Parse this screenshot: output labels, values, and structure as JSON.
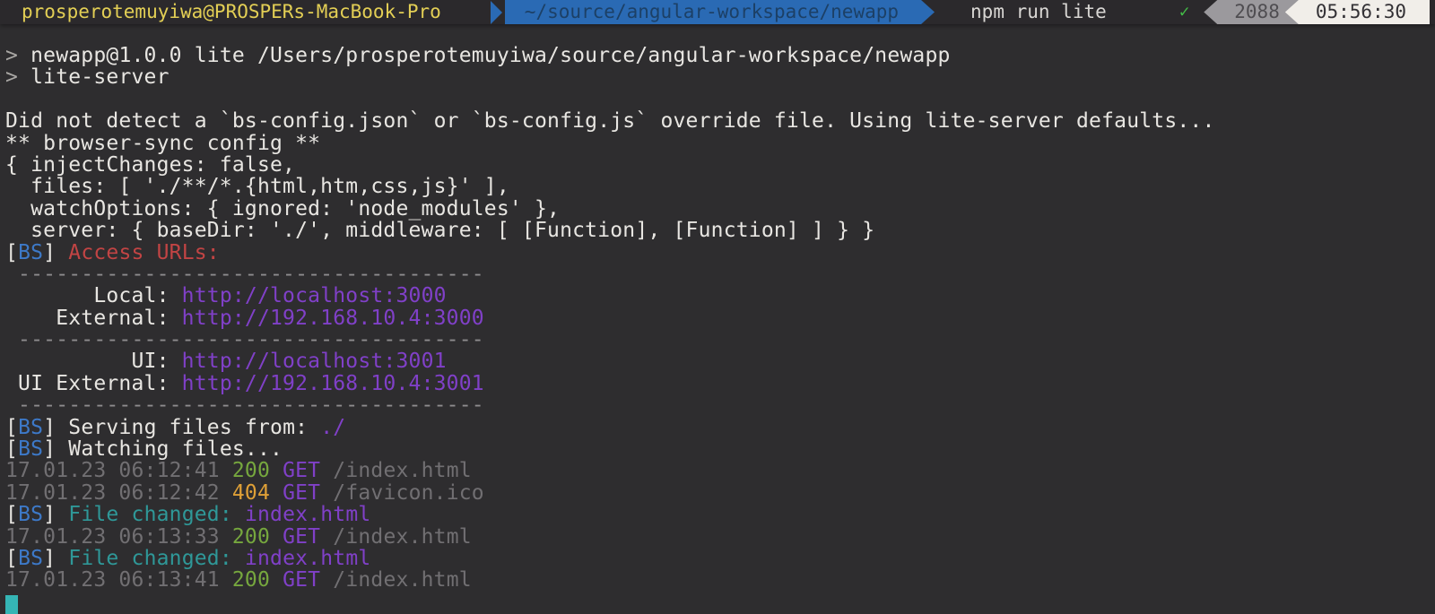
{
  "terminal": {
    "topbar": {
      "user_host": "prosperotemuyiwa@PROSPERs-MacBook-Pro",
      "cwd": "~/source/angular-workspace/newapp",
      "command": "npm run lite",
      "status_ok_icon": "✓",
      "history_number": "2088",
      "clock": "05:56:30"
    },
    "palette": {
      "bg": "#2e2d2f",
      "bar_bg": "#2b292c",
      "bar_yellow": "#e3cf55",
      "bar_blue_bg": "#2a6ab4",
      "bar_blue_fg": "#1c4066",
      "bar_cmd": "#d8d6d3",
      "check_green": "#43bd47",
      "hist_bg": "#9b999d",
      "hist_fg": "#4f4d51",
      "time_bg": "#f1eee9",
      "time_fg": "#333135",
      "fg": "#e8e6e2",
      "dim": "#a9a7a4",
      "blue": "#3d79c8",
      "red": "#c24444",
      "purple": "#8040c8",
      "sep": "#8e8c8e",
      "gray": "#716f72",
      "green": "#76a73e",
      "amber": "#dfa037",
      "teal": "#2f9898",
      "cursor": "#35b5b5"
    },
    "lines": [
      {
        "segments": [
          {
            "t": "> ",
            "c": "dim"
          },
          {
            "t": "newapp@1.0.0 lite /Users/prosperotemuyiwa/source/angular-workspace/newapp",
            "c": "fg"
          }
        ]
      },
      {
        "segments": [
          {
            "t": "> ",
            "c": "dim"
          },
          {
            "t": "lite-server",
            "c": "fg"
          }
        ]
      },
      {
        "segments": []
      },
      {
        "segments": [
          {
            "t": "Did not detect a `bs-config.json` or `bs-config.js` override file. Using lite-server defaults...",
            "c": "fg"
          }
        ]
      },
      {
        "segments": [
          {
            "t": "** browser-sync config **",
            "c": "fg"
          }
        ]
      },
      {
        "segments": [
          {
            "t": "{ injectChanges: false,",
            "c": "fg"
          }
        ]
      },
      {
        "segments": [
          {
            "t": "  files: [ './**/*.{html,htm,css,js}' ],",
            "c": "fg"
          }
        ]
      },
      {
        "segments": [
          {
            "t": "  watchOptions: { ignored: 'node_modules' },",
            "c": "fg"
          }
        ]
      },
      {
        "segments": [
          {
            "t": "  server: { baseDir: './', middleware: [ [Function], [Function] ] } }",
            "c": "fg"
          }
        ]
      },
      {
        "segments": [
          {
            "t": "[",
            "c": "fg"
          },
          {
            "t": "BS",
            "c": "blue"
          },
          {
            "t": "] ",
            "c": "fg"
          },
          {
            "t": "Access URLs:",
            "c": "red"
          }
        ]
      },
      {
        "segments": [
          {
            "t": " -------------------------------------",
            "c": "sep"
          }
        ]
      },
      {
        "segments": [
          {
            "t": "       Local: ",
            "c": "fg"
          },
          {
            "t": "http://localhost:3000",
            "c": "purple",
            "name": "url-local",
            "inter": true
          }
        ]
      },
      {
        "segments": [
          {
            "t": "    External: ",
            "c": "fg"
          },
          {
            "t": "http://192.168.10.4:3000",
            "c": "purple",
            "name": "url-external",
            "inter": true
          }
        ]
      },
      {
        "segments": [
          {
            "t": " -------------------------------------",
            "c": "sep"
          }
        ]
      },
      {
        "segments": [
          {
            "t": "          UI: ",
            "c": "fg"
          },
          {
            "t": "http://localhost:3001",
            "c": "purple",
            "name": "url-ui",
            "inter": true
          }
        ]
      },
      {
        "segments": [
          {
            "t": " UI External: ",
            "c": "fg"
          },
          {
            "t": "http://192.168.10.4:3001",
            "c": "purple",
            "name": "url-ui-external",
            "inter": true
          }
        ]
      },
      {
        "segments": [
          {
            "t": " -------------------------------------",
            "c": "sep"
          }
        ]
      },
      {
        "segments": [
          {
            "t": "[",
            "c": "fg"
          },
          {
            "t": "BS",
            "c": "blue"
          },
          {
            "t": "] ",
            "c": "fg"
          },
          {
            "t": "Serving files from: ",
            "c": "fg"
          },
          {
            "t": "./",
            "c": "purple"
          }
        ]
      },
      {
        "segments": [
          {
            "t": "[",
            "c": "fg"
          },
          {
            "t": "BS",
            "c": "blue"
          },
          {
            "t": "] ",
            "c": "fg"
          },
          {
            "t": "Watching files...",
            "c": "fg"
          }
        ]
      },
      {
        "segments": [
          {
            "t": "17.01.23 06:12:41 ",
            "c": "gray"
          },
          {
            "t": "200",
            "c": "green"
          },
          {
            "t": " ",
            "c": "gray"
          },
          {
            "t": "GET",
            "c": "purple"
          },
          {
            "t": " /index.html",
            "c": "gray"
          }
        ]
      },
      {
        "segments": [
          {
            "t": "17.01.23 06:12:42 ",
            "c": "gray"
          },
          {
            "t": "404",
            "c": "amber"
          },
          {
            "t": " ",
            "c": "gray"
          },
          {
            "t": "GET",
            "c": "purple"
          },
          {
            "t": " /favicon.ico",
            "c": "gray"
          }
        ]
      },
      {
        "segments": [
          {
            "t": "[",
            "c": "fg"
          },
          {
            "t": "BS",
            "c": "blue"
          },
          {
            "t": "] ",
            "c": "fg"
          },
          {
            "t": "File changed: ",
            "c": "teal"
          },
          {
            "t": "index.html",
            "c": "purple"
          }
        ]
      },
      {
        "segments": [
          {
            "t": "17.01.23 06:13:33 ",
            "c": "gray"
          },
          {
            "t": "200",
            "c": "green"
          },
          {
            "t": " ",
            "c": "gray"
          },
          {
            "t": "GET",
            "c": "purple"
          },
          {
            "t": " /index.html",
            "c": "gray"
          }
        ]
      },
      {
        "segments": [
          {
            "t": "[",
            "c": "fg"
          },
          {
            "t": "BS",
            "c": "blue"
          },
          {
            "t": "] ",
            "c": "fg"
          },
          {
            "t": "File changed: ",
            "c": "teal"
          },
          {
            "t": "index.html",
            "c": "purple"
          }
        ]
      },
      {
        "segments": [
          {
            "t": "17.01.23 06:13:41 ",
            "c": "gray"
          },
          {
            "t": "200",
            "c": "green"
          },
          {
            "t": " ",
            "c": "gray"
          },
          {
            "t": "GET",
            "c": "purple"
          },
          {
            "t": " /index.html",
            "c": "gray"
          }
        ]
      },
      {
        "segments": [
          {
            "cursor": true
          }
        ]
      }
    ]
  }
}
